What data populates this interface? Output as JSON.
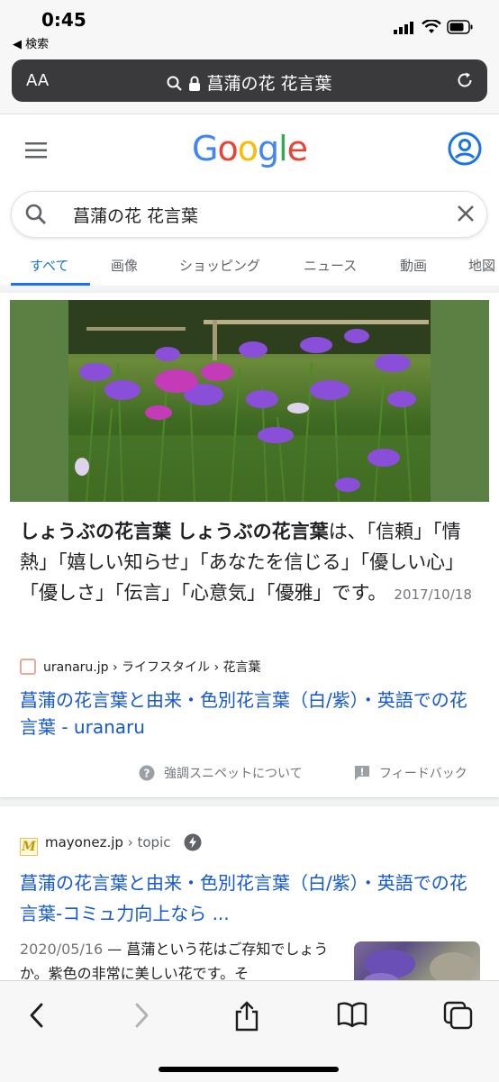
{
  "status": {
    "time": "0:45",
    "back_label": "◀ 検索"
  },
  "urlbar": {
    "aa_label": "AA",
    "url_text": "菖蒲の花 花言葉"
  },
  "google": {
    "logo_letters": [
      "G",
      "o",
      "o",
      "g",
      "l",
      "e"
    ],
    "logo_colors": [
      "#4285f4",
      "#ea4335",
      "#fbbc05",
      "#4285f4",
      "#34a853",
      "#ea4335"
    ]
  },
  "search": {
    "query": "菖蒲の花 花言葉"
  },
  "tabs": [
    {
      "label": "すべて"
    },
    {
      "label": "画像"
    },
    {
      "label": "ショッピング"
    },
    {
      "label": "ニュース"
    },
    {
      "label": "動画"
    },
    {
      "label": "地図"
    }
  ],
  "featured": {
    "snippet_bold1": "しょうぶの花言葉",
    "snippet_bold2": "しょうぶの花言葉",
    "snippet_text": "は、「信頼」「情熱」「嬉しい知らせ」「あなたを信じる」「優しい心」「優しさ」「伝言」「心意気」「優雅」です。",
    "date": "2017/10/18",
    "source": "uranaru.jp › ライフスタイル › 花言葉",
    "link_title": "菖蒲の花言葉と由来・色別花言葉（白/紫）・英語での花言葉 - uranaru",
    "about_label": "強調スニペットについて",
    "feedback_label": "フィードバック"
  },
  "result2": {
    "domain": "mayonez.jp",
    "path": "› topic",
    "favicon_letter": "M",
    "link_title": "菖蒲の花言葉と由来・色別花言葉（白/紫）・英語での花言葉-コミュ力向上なら ...",
    "date": "2020/05/16",
    "snippet": "菖蒲という花はご存知でしょうか。紫色の非常に美しい花です。そ"
  },
  "colors": {
    "accent": "#1a73e8",
    "link": "#1558d6",
    "hero_bg": "#5b8043"
  }
}
